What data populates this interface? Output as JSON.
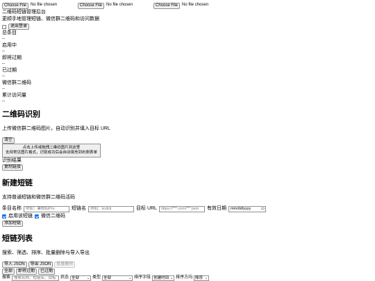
{
  "file_pickers": [
    {
      "button": "Choose File",
      "status": "No file chosen"
    },
    {
      "button": "Choose File",
      "status": "No file chosen"
    },
    {
      "button": "Choose File",
      "status": "No file chosen"
    }
  ],
  "header": {
    "title": "二维码短链管理后台",
    "subtitle": "更顺手地管理短链、微信群二维码和访问数据",
    "logout": "退出登录"
  },
  "stats": [
    {
      "label": "总条目",
      "value": "--"
    },
    {
      "label": "启用中",
      "value": "--"
    },
    {
      "label": "即将过期",
      "value": "--"
    },
    {
      "label": "已过期",
      "value": "--"
    },
    {
      "label": "微信群二维码",
      "value": "--"
    },
    {
      "label": "累计访问量",
      "value": "--"
    }
  ],
  "qr_section": {
    "title": "二维码识别",
    "desc": "上传微信群二维码图片，自动识别并填入目标 URL",
    "clear": "清空",
    "drop_line1": "点击上传或拖拽二维码图片到这里",
    "drop_line2": "支持常见图片格式，识别成功后会自动填充到右侧表单",
    "result_label": "识别结果",
    "copy_link": "复制链接"
  },
  "new_link": {
    "title": "新建短链",
    "desc": "支持普通短链和微信群二维码活码",
    "name_label": "条目名称",
    "name_placeholder": "例如：暑假招Pro",
    "short_label": "短链名",
    "short_placeholder": "例如：kcdck",
    "url_label": "目标 URL",
    "url_placeholder": "https://***.com/***.json",
    "expire_label": "有效日期",
    "expire_placeholder": "mm/dd/yyyy",
    "enable_label": "启用该短链",
    "wechat_label": "微信二维码",
    "add_button": "添加短链"
  },
  "list": {
    "title": "短链列表",
    "desc": "搜索、筛选、排序、批量删除与导入导出",
    "import": "导入 JSON",
    "export": "导出 JSON",
    "batch_delete": "批量删除",
    "filter_all": "全部",
    "filter_soon": "即将过期",
    "filter_expired": "已过期",
    "search_label": "搜索",
    "search_placeholder": "搜索名称、短链名、目标",
    "status_label": "状态",
    "status_value": "全部",
    "type_label": "类型",
    "type_value": "全部",
    "sort_field_label": "排序字段",
    "sort_field_value": "创建时间",
    "sort_dir_label": "排序方向",
    "sort_dir_value": "降序"
  },
  "icons": {
    "calendar": "calendar-icon",
    "caret": "chevron-down-icon"
  },
  "colors": {
    "checkbox": "#1a73e8"
  }
}
